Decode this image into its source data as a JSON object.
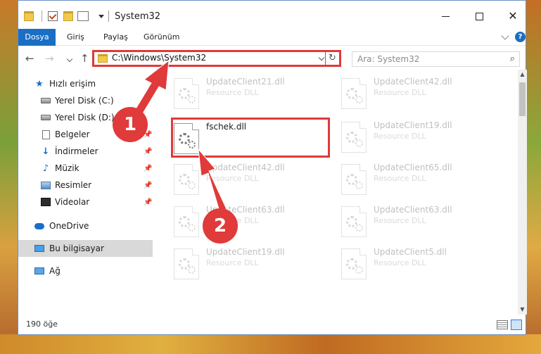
{
  "window": {
    "title": "System32"
  },
  "ribbon": {
    "tabs": [
      {
        "label": "Dosya",
        "active": true
      },
      {
        "label": "Giriş"
      },
      {
        "label": "Paylaş"
      },
      {
        "label": "Görünüm"
      }
    ],
    "help": "?"
  },
  "addressbar": {
    "path": "C:\\Windows\\System32",
    "search_placeholder": "Ara: System32"
  },
  "sidebar": {
    "items": [
      {
        "label": "Hızlı erişim",
        "icon": "star-icon"
      },
      {
        "label": "Yerel Disk (C:)",
        "icon": "disk-icon",
        "pinned": true
      },
      {
        "label": "Yerel Disk (D:)",
        "icon": "disk-icon",
        "pinned": true
      },
      {
        "label": "Belgeler",
        "icon": "document-icon",
        "pinned": true
      },
      {
        "label": "İndirmeler",
        "icon": "download-icon",
        "pinned": true
      },
      {
        "label": "Müzik",
        "icon": "music-icon",
        "pinned": true
      },
      {
        "label": "Resimler",
        "icon": "pictures-icon",
        "pinned": true
      },
      {
        "label": "Videolar",
        "icon": "video-icon",
        "pinned": true
      },
      {
        "label": "OneDrive",
        "icon": "cloud-icon"
      },
      {
        "label": "Bu bilgisayar",
        "icon": "computer-icon",
        "selected": true
      },
      {
        "label": "Ağ",
        "icon": "network-icon"
      }
    ]
  },
  "files": [
    {
      "name": "UpdateClient21.dll",
      "type": "Resource DLL"
    },
    {
      "name": "UpdateClient42.dll",
      "type": "Resource DLL"
    },
    {
      "name": "fschek.dll",
      "type": ""
    },
    {
      "name": "UpdateClient19.dll",
      "type": "Resource DLL"
    },
    {
      "name": "UpdateClient42.dll",
      "type": "Resource DLL"
    },
    {
      "name": "UpdateClient65.dll",
      "type": "Resource DLL"
    },
    {
      "name": "UpdateClient63.dll",
      "type": "Resource DLL"
    },
    {
      "name": "UpdateClient63.dll",
      "type": "Resource DLL"
    },
    {
      "name": "UpdateClient19.dll",
      "type": "Resource DLL"
    },
    {
      "name": "UpdateClient5.dll",
      "type": "Resource DLL"
    }
  ],
  "status": {
    "count": "190 öğe"
  },
  "annotations": {
    "step1": "1",
    "step2": "2",
    "color": "#e03a3a"
  }
}
